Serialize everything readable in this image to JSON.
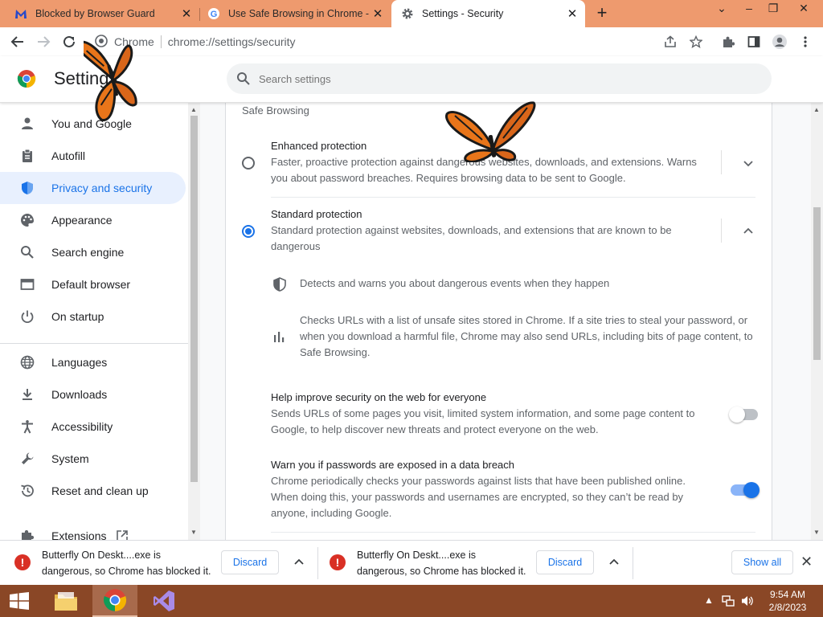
{
  "tabs": [
    {
      "title": "Blocked by Browser Guard",
      "icon": "malwarebytes-icon",
      "active": false
    },
    {
      "title": "Use Safe Browsing in Chrome - C",
      "icon": "google-icon",
      "active": false
    },
    {
      "title": "Settings - Security",
      "icon": "gear-icon",
      "active": true
    }
  ],
  "omnibox": {
    "site": "Chrome",
    "url": "chrome://settings/security"
  },
  "settings": {
    "title": "Settings",
    "search_placeholder": "Search settings"
  },
  "sidebar": {
    "items": [
      {
        "label": "You and Google",
        "icon": "person-icon"
      },
      {
        "label": "Autofill",
        "icon": "clipboard-icon"
      },
      {
        "label": "Privacy and security",
        "icon": "shield-icon",
        "selected": true
      },
      {
        "label": "Appearance",
        "icon": "palette-icon"
      },
      {
        "label": "Search engine",
        "icon": "search-icon"
      },
      {
        "label": "Default browser",
        "icon": "browser-icon"
      },
      {
        "label": "On startup",
        "icon": "power-icon"
      },
      {
        "label": "Languages",
        "icon": "globe-icon"
      },
      {
        "label": "Downloads",
        "icon": "download-icon"
      },
      {
        "label": "Accessibility",
        "icon": "accessibility-icon"
      },
      {
        "label": "System",
        "icon": "wrench-icon"
      },
      {
        "label": "Reset and clean up",
        "icon": "restore-icon"
      },
      {
        "label": "Extensions",
        "icon": "puzzle-icon"
      }
    ]
  },
  "safe_browsing": {
    "section_title": "Safe Browsing",
    "enhanced": {
      "title": "Enhanced protection",
      "desc_line1": "Faster, proactive protection against dangerous websites, downloads, and extensions. Warns",
      "desc_line2": "you about password breaches. Requires browsing data to be sent to Google.",
      "checked": false
    },
    "standard": {
      "title": "Standard protection",
      "desc_line1": "Standard protection against websites, downloads, and extensions that are known to be",
      "desc_line2": "dangerous",
      "checked": true,
      "detail1": "Detects and warns you about dangerous events when they happen",
      "detail2_line1": "Checks URLs with a list of unsafe sites stored in Chrome. If a site tries to steal your password, or",
      "detail2_line2": "when you download a harmful file, Chrome may also send URLs, including bits of page content, to",
      "detail2_line3": "Safe Browsing."
    },
    "help_improve": {
      "title": "Help improve security on the web for everyone",
      "desc_line1": "Sends URLs of some pages you visit, limited system information, and some page content to",
      "desc_line2": "Google, to help discover new threats and protect everyone on the web.",
      "enabled": false
    },
    "password_warn": {
      "title": "Warn you if passwords are exposed in a data breach",
      "desc_line1": "Chrome periodically checks your passwords against lists that have been published online.",
      "desc_line2": "When doing this, your passwords and usernames are encrypted, so they can’t be read by",
      "desc_line3": "anyone, including Google.",
      "enabled": true
    }
  },
  "downloads": {
    "items": [
      {
        "line1": "Butterfly On Deskt....exe is",
        "line2": "dangerous, so Chrome has blocked it.",
        "discard": "Discard"
      },
      {
        "line1": "Butterfly On Deskt....exe is",
        "line2": "dangerous, so Chrome has blocked it.",
        "discard": "Discard"
      }
    ],
    "show_all": "Show all"
  },
  "taskbar": {
    "time": "9:54 AM",
    "date": "2/8/2023"
  },
  "colors": {
    "accent": "#1a73e8",
    "tabstrip": "#ee9a6e",
    "taskbar": "#8a4726",
    "danger": "#d93025"
  }
}
